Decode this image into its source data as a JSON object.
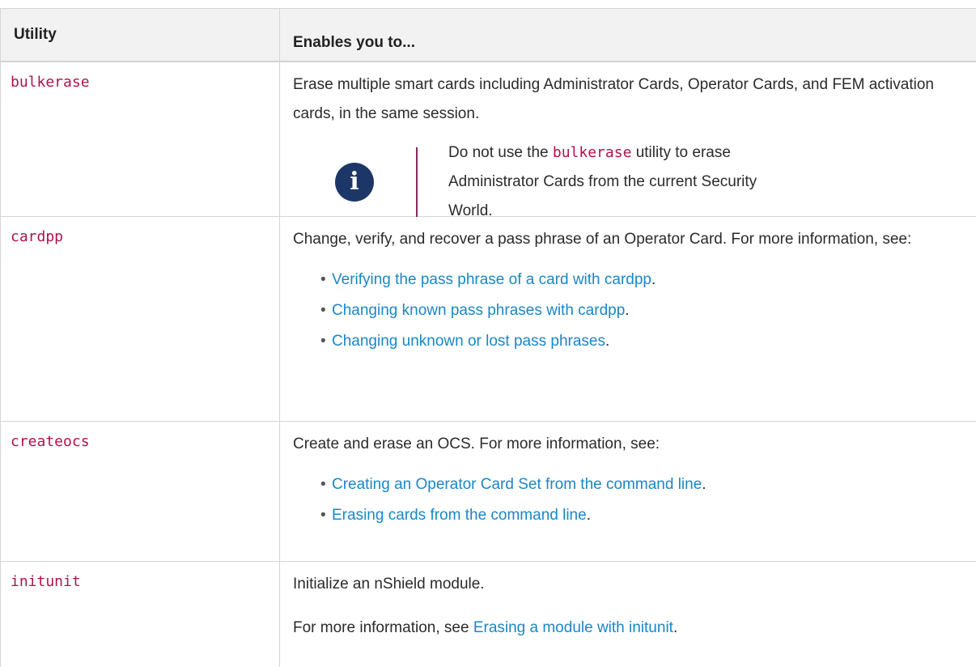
{
  "table": {
    "headers": [
      "Utility",
      "Enables you to..."
    ],
    "rows": [
      {
        "utility": "bulkerase",
        "desc": "Erase multiple smart cards including Administrator Cards, Operator Cards, and FEM activation cards, in the same session.",
        "note": {
          "before": "Do not use the ",
          "code": "bulkerase",
          "after": " utility to erase Administrator Cards from the current Security World."
        }
      },
      {
        "utility": "cardpp",
        "desc": "Change, verify, and recover a pass phrase of an Operator Card. For more information, see:",
        "links": [
          "Verifying the pass phrase of a card with cardpp",
          "Changing known pass phrases with cardpp",
          "Changing unknown or lost pass phrases"
        ]
      },
      {
        "utility": "createocs",
        "desc": "Create and erase an OCS. For more information, see:",
        "links": [
          "Creating an Operator Card Set from the command line",
          "Erasing cards from the command line"
        ]
      },
      {
        "utility": "initunit",
        "desc": "Initialize an nShield module.",
        "more_prefix": "For more information, see ",
        "more_link": "Erasing a module with initunit"
      }
    ]
  },
  "icons": {
    "note": "info-icon"
  },
  "colors": {
    "code": "#b0124b",
    "link": "#1a87c6",
    "note_icon": "#1c3767",
    "note_bar": "#8a2a5e"
  }
}
